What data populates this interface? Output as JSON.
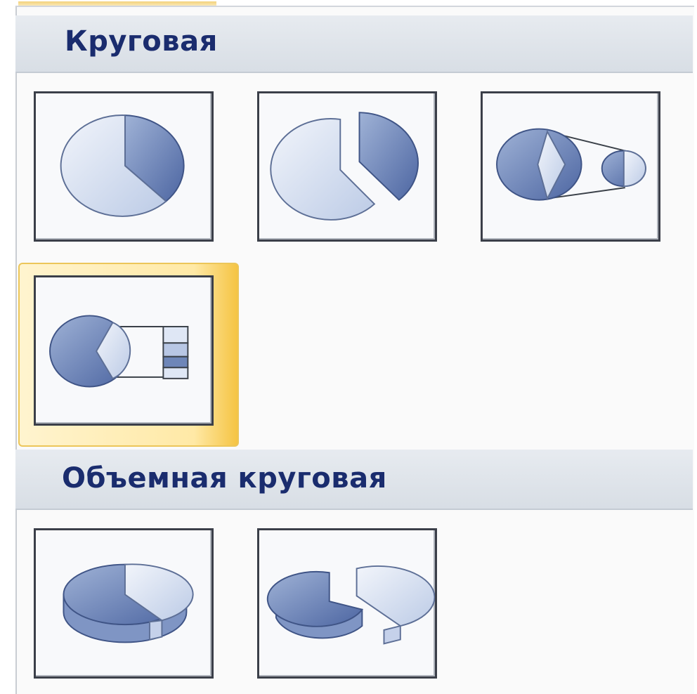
{
  "gallery": {
    "sections": [
      {
        "title": "Круговая"
      },
      {
        "title": "Объемная круговая"
      }
    ],
    "selected_item": "pie-of-pie-bar-chart"
  },
  "colors": {
    "header_text": "#1a2c6e",
    "selection": "#f5c443",
    "slice_dark": "#6e86b8",
    "slice_light": "#dfe7f5"
  }
}
